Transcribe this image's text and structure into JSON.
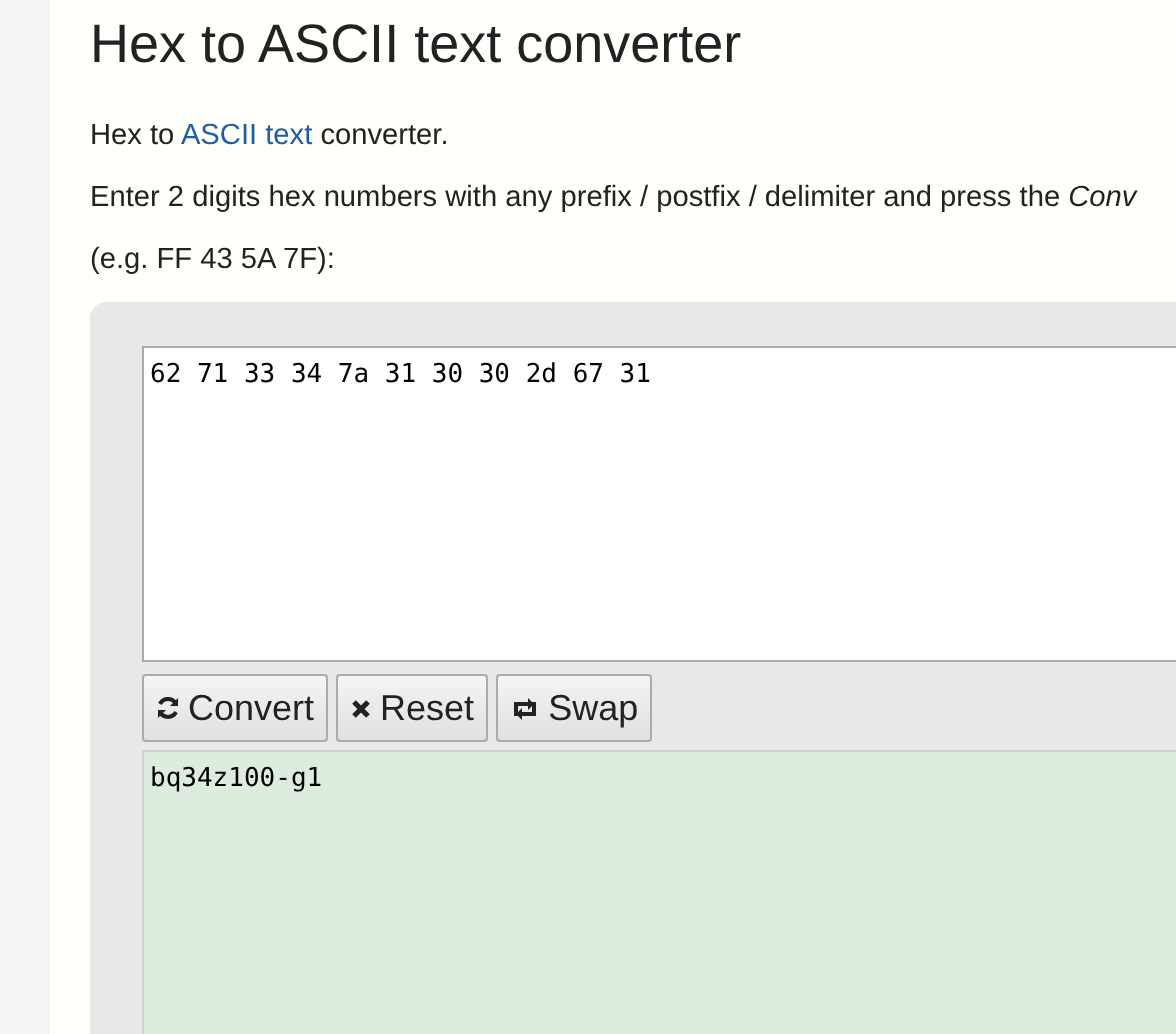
{
  "title": "Hex to ASCII text converter",
  "intro": {
    "before": "Hex to ",
    "link": "ASCII text",
    "after": " converter."
  },
  "instructions": "Enter 2 digits hex numbers with any prefix / postfix / delimiter and press the *Conv*",
  "example": "(e.g. FF 43 5A 7F):",
  "input": {
    "value": "62 71 33 34 7a 31 30 30 2d 67 31"
  },
  "buttons": [
    {
      "kind": "convert",
      "label": "Convert"
    },
    {
      "kind": "reset",
      "label": "Reset"
    },
    {
      "kind": "swap",
      "label": "Swap"
    }
  ],
  "output": {
    "value": "bq34z100-g1"
  }
}
